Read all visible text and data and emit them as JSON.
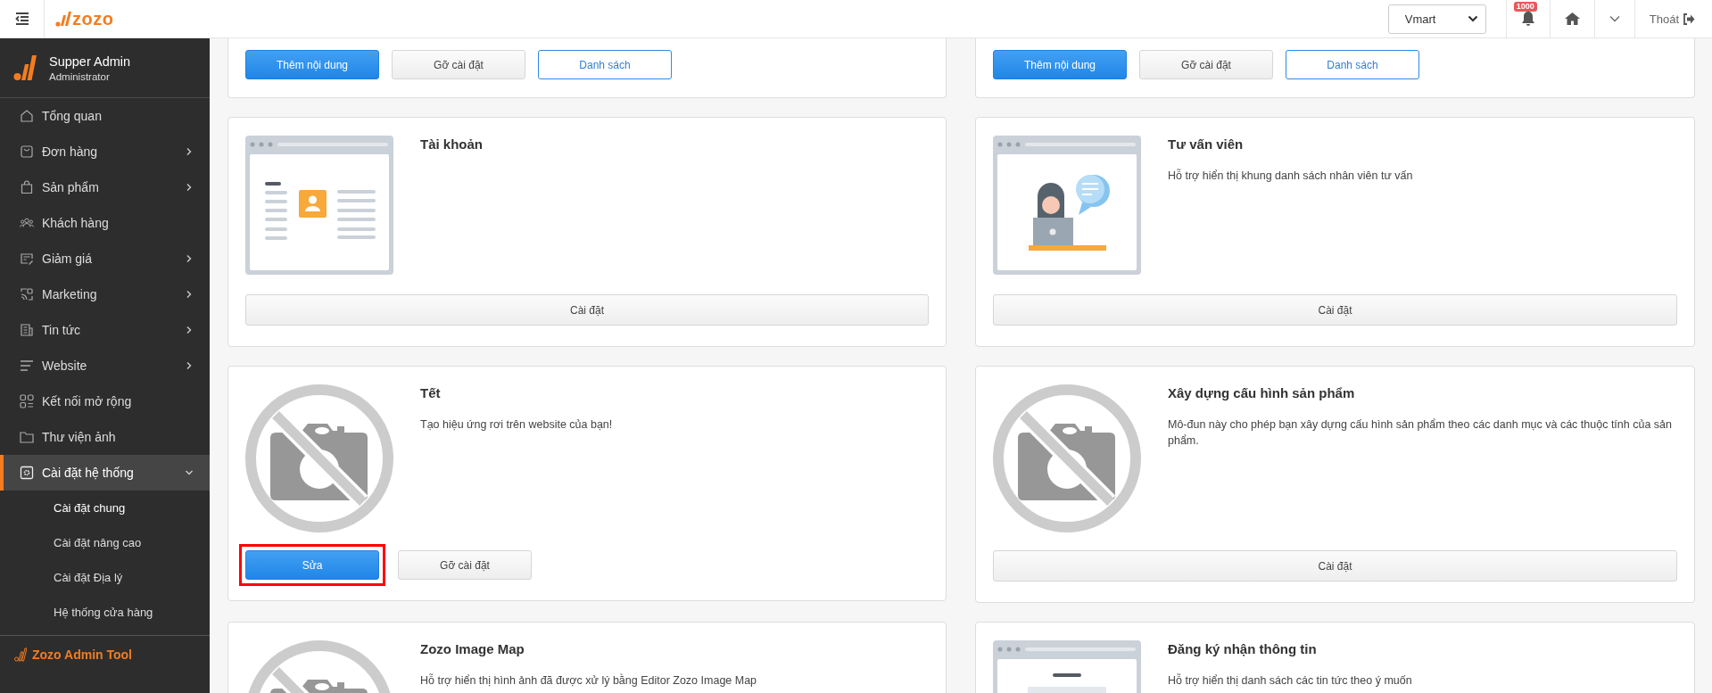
{
  "topbar": {
    "logo": "zozo",
    "store_select": {
      "value": "Vmart"
    },
    "notifications": {
      "badge": "1000"
    },
    "logout": "Thoát"
  },
  "sidebar": {
    "user": {
      "name": "Supper Admin",
      "role": "Administrator"
    },
    "items": [
      {
        "label": "Tổng quan",
        "kind": "home",
        "has_submenu": false,
        "selected": false
      },
      {
        "label": "Đơn hàng",
        "kind": "box",
        "has_submenu": true,
        "expanded": false,
        "selected": false
      },
      {
        "label": "Sản phẩm",
        "kind": "bag",
        "has_submenu": true,
        "expanded": false,
        "selected": false
      },
      {
        "label": "Khách hàng",
        "kind": "people",
        "has_submenu": false,
        "selected": false
      },
      {
        "label": "Giảm giá",
        "kind": "voucher",
        "has_submenu": true,
        "expanded": false,
        "selected": false
      },
      {
        "label": "Marketing",
        "kind": "broadcast",
        "has_submenu": true,
        "expanded": false,
        "selected": false
      },
      {
        "label": "Tin tức",
        "kind": "news",
        "has_submenu": true,
        "expanded": false,
        "selected": false
      },
      {
        "label": "Website",
        "kind": "lines",
        "has_submenu": true,
        "expanded": false,
        "selected": false
      },
      {
        "label": "Kết nối mở rộng",
        "kind": "grid",
        "has_submenu": false,
        "selected": false
      },
      {
        "label": "Thư viện ảnh",
        "kind": "folder",
        "has_submenu": false,
        "selected": false
      },
      {
        "label": "Cài đặt hệ thống",
        "kind": "gear",
        "has_submenu": true,
        "expanded": true,
        "selected": true,
        "children": [
          {
            "label": "Cài đặt chung",
            "selected": true
          },
          {
            "label": "Cài đặt nâng cao",
            "selected": false
          },
          {
            "label": "Cài đặt Địa lý",
            "selected": false
          },
          {
            "label": "Hệ thống cửa hàng",
            "selected": false
          }
        ]
      }
    ],
    "footer": "Zozo Admin Tool"
  },
  "cards": [
    {
      "buttons": [
        {
          "label": "Thêm nội dung",
          "kind": "primary",
          "highlighted": false
        },
        {
          "label": "Gỡ cài đặt",
          "kind": "default",
          "highlighted": false
        },
        {
          "label": "Danh sách",
          "kind": "outline",
          "highlighted": false
        }
      ]
    },
    {
      "buttons": [
        {
          "label": "Thêm nội dung",
          "kind": "primary",
          "highlighted": false
        },
        {
          "label": "Gỡ cài đặt",
          "kind": "default",
          "highlighted": false
        },
        {
          "label": "Danh sách",
          "kind": "outline",
          "highlighted": false
        }
      ]
    },
    {
      "kind": "profile-page",
      "title": "Tài khoản",
      "buttons": [
        {
          "label": "Cài đặt",
          "kind": "wide",
          "highlighted": false
        }
      ]
    },
    {
      "kind": "consultant",
      "title": "Tư vấn viên",
      "description": "Hỗ trợ hiển thị khung danh sách nhân viên tư vấn",
      "buttons": [
        {
          "label": "Cài đặt",
          "kind": "wide",
          "highlighted": false
        }
      ]
    },
    {
      "kind": "no-photo",
      "title": "Tết",
      "description": "Tạo hiệu ứng rơi trên website của bạn!",
      "buttons": [
        {
          "label": "Sửa",
          "kind": "primary",
          "highlighted": true
        },
        {
          "label": "Gỡ cài đặt",
          "kind": "default",
          "highlighted": false
        }
      ]
    },
    {
      "kind": "no-photo",
      "title": "Xây dựng cấu hình sản phẩm",
      "description": "Mô-đun này cho phép bạn xây dựng cấu hình sản phẩm theo các danh mục và các thuộc tính của sản phẩm.",
      "buttons": [
        {
          "label": "Cài đặt",
          "kind": "wide",
          "highlighted": false
        }
      ]
    },
    {
      "kind": "no-photo",
      "title": "Zozo Image Map",
      "description": "Hỗ trợ hiển thị hình ảnh đã được xử lý bằng Editor Zozo Image Map"
    },
    {
      "kind": "form-page",
      "title": "Đăng ký nhận thông tin",
      "description": "Hỗ trợ hiển thị danh sách các tin tức theo ý muốn"
    }
  ]
}
